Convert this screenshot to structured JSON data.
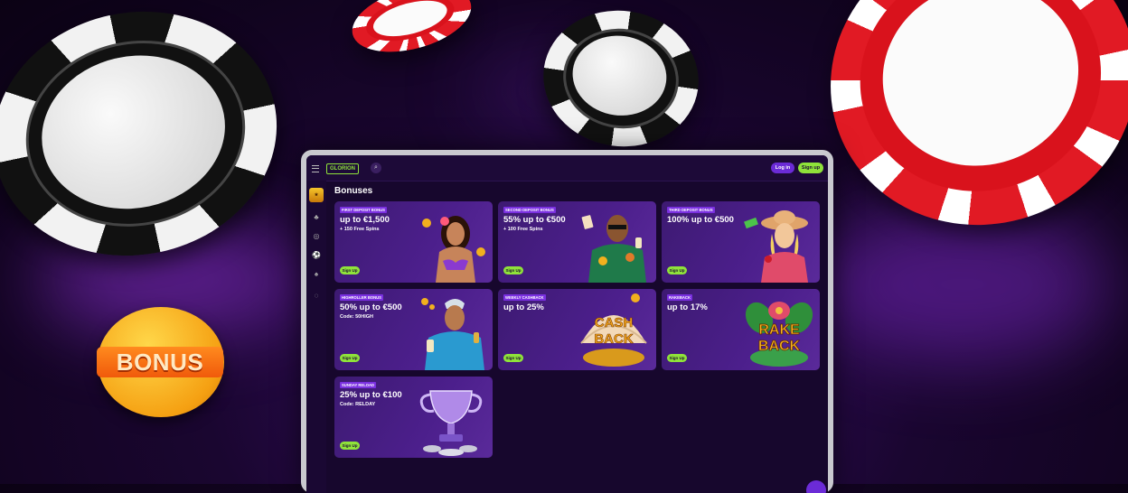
{
  "hero": {
    "bonus_badge": "BONUS"
  },
  "site": {
    "logo_text": "GLORION",
    "login_label": "Log in",
    "signup_label": "Sign up",
    "page_title": "Bonuses"
  },
  "bonuses": [
    {
      "tag": "FIRST DEPOSIT BONUS",
      "headline": "up to €1,500",
      "subline": "+ 150 Free Spins",
      "button": "Sign Up",
      "art": "woman-with-flower-icon"
    },
    {
      "tag": "SECOND DEPOSIT BONUS",
      "headline": "55% up to €500",
      "subline": "+ 100 Free Spins",
      "button": "Sign Up",
      "art": "man-with-cards-icon"
    },
    {
      "tag": "THIRD DEPOSIT BONUS",
      "headline": "100% up to €500",
      "subline": "",
      "button": "Sign Up",
      "art": "woman-with-hat-icon"
    },
    {
      "tag": "HIGHROLLER BONUS",
      "headline": "50% up to €500",
      "subline": "Code: 50HIGH",
      "button": "Sign Up",
      "art": "man-with-drink-icon"
    },
    {
      "tag": "WEEKLY CASHBACK",
      "headline": "up to 25%",
      "subline": "",
      "button": "Sign Up",
      "art": "cash-back-icon",
      "art_text": "CASH BACK"
    },
    {
      "tag": "RAKEBACK",
      "headline": "up to 17%",
      "subline": "",
      "button": "Sign Up",
      "art": "rake-back-icon",
      "art_text": "RAKE BACK"
    },
    {
      "tag": "SUNDAY RELOAD",
      "headline": "25% up to €100",
      "subline": "Code: RELDAY",
      "button": "Sign Up",
      "art": "trophy-icon"
    }
  ]
}
